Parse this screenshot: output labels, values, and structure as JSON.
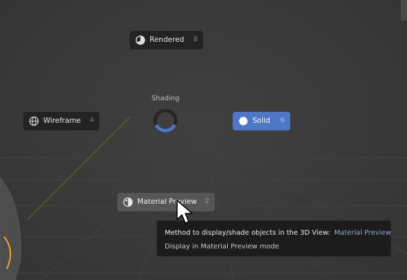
{
  "pie_menu": {
    "title": "Shading",
    "items": [
      {
        "id": "rendered",
        "label": "Rendered",
        "shortcut": "8",
        "icon": "rendered-shading-icon"
      },
      {
        "id": "wireframe",
        "label": "Wireframe",
        "shortcut": "4",
        "icon": "wireframe-shading-icon"
      },
      {
        "id": "solid",
        "label": "Solid",
        "shortcut": "6",
        "icon": "solid-shading-icon",
        "active": true
      },
      {
        "id": "material",
        "label": "Material Preview",
        "shortcut": "2",
        "icon": "material-preview-icon",
        "hovered": true
      }
    ]
  },
  "tooltip": {
    "title": "Method to display/shade objects in the 3D View:",
    "value": "Material Preview",
    "description": "Display in Material Preview mode"
  },
  "colors": {
    "viewport_bg": "#3a3a3a",
    "active_item": "#4f78c4",
    "hover_item": "#565656",
    "menu_item_bg": "#232323",
    "tooltip_bg": "#1c1c1c",
    "tooltip_value": "#95a9d6",
    "selection_outline": "#f5a623"
  }
}
